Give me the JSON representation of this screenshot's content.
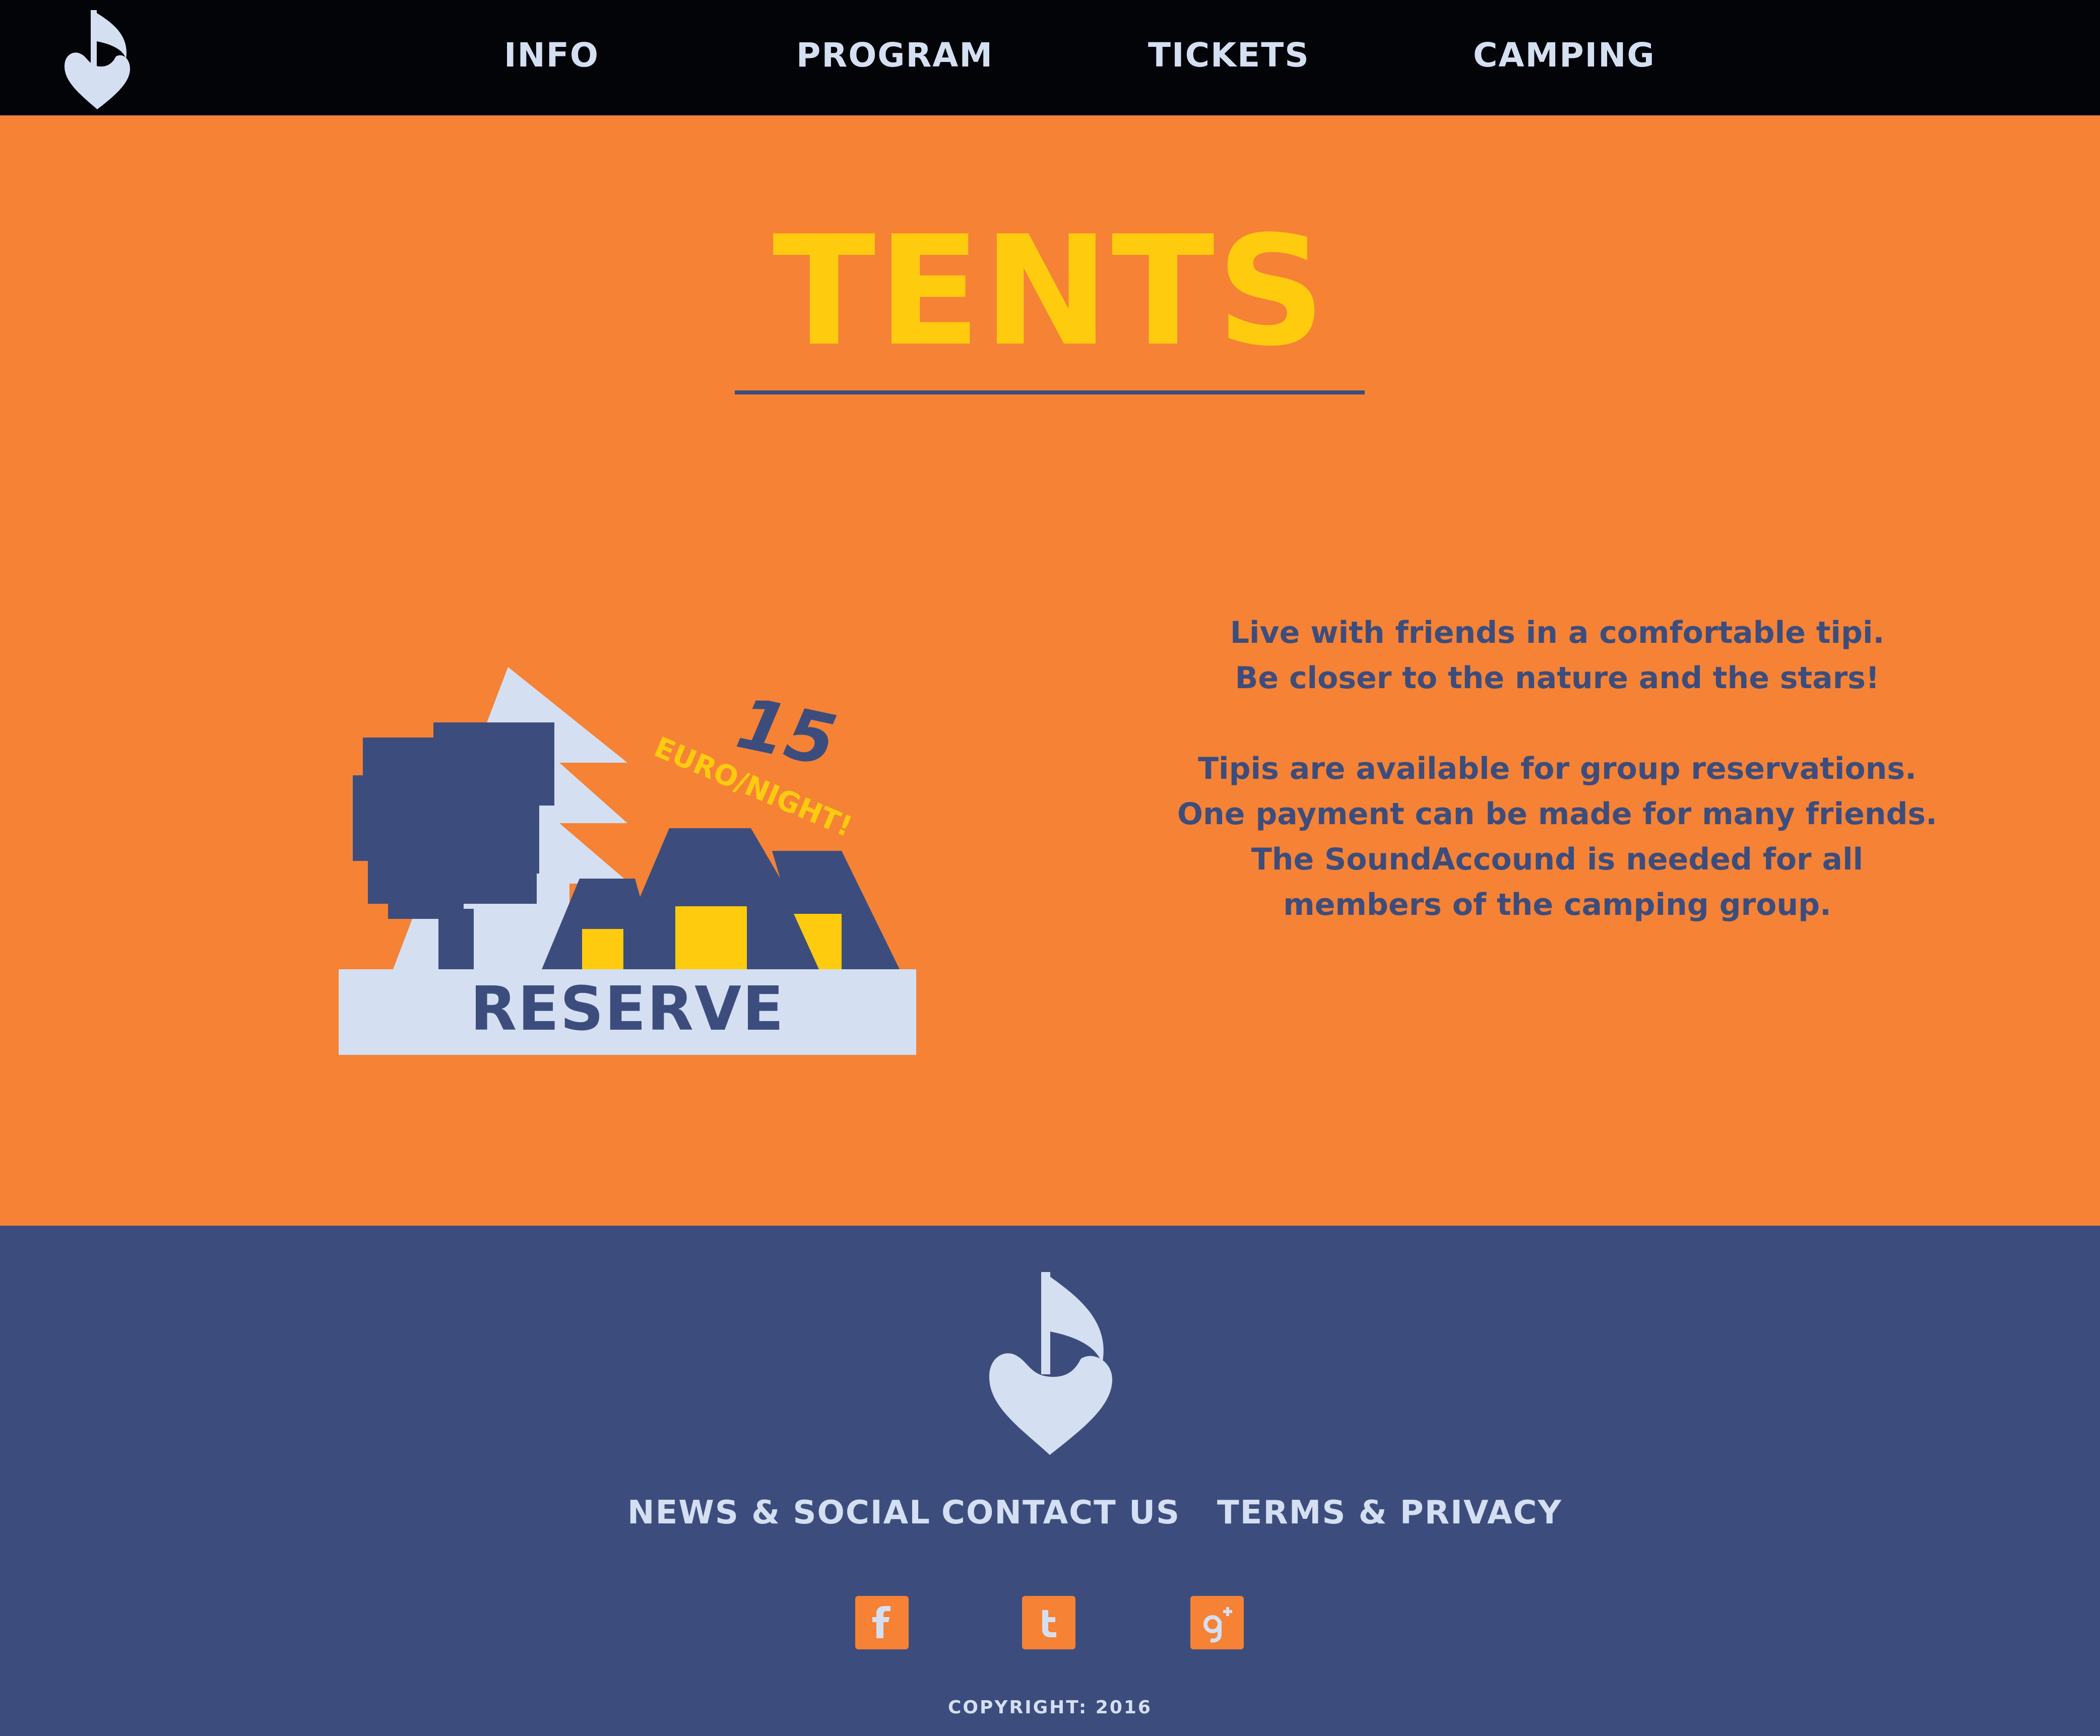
{
  "colors": {
    "nav_bg": "#030408",
    "page_bg": "#F58235",
    "title": "#FFCB0E",
    "accent_dark": "#3C4D7D",
    "light": "#D5DFF2",
    "footer_bg": "#3C4D7D"
  },
  "nav": {
    "logo_icon": "music-note-heart-icon",
    "items": [
      {
        "label": "INFO"
      },
      {
        "label": "PROGRAM"
      },
      {
        "label": "TICKETS"
      },
      {
        "label": "CAMPING"
      }
    ]
  },
  "main": {
    "title": "TENTS",
    "reserve": {
      "label": "RESERVE",
      "price_number": "15",
      "price_unit": "EURO/NIGHT!"
    },
    "description": [
      "Live with friends in a comfortable tipi.",
      "Be closer to the nature and the stars!",
      "",
      "Tipis are available for group reservations.",
      "One payment can be made for many friends.",
      "The SoundAccound is needed for all",
      "members of the camping group."
    ]
  },
  "footer": {
    "logo_icon": "music-note-heart-icon",
    "links": [
      {
        "label": "NEWS & SOCIAL"
      },
      {
        "label": "CONTACT US"
      },
      {
        "label": "TERMS & PRIVACY"
      }
    ],
    "social": [
      {
        "icon": "facebook-icon",
        "glyph": "f"
      },
      {
        "icon": "twitter-icon",
        "glyph": "t"
      },
      {
        "icon": "google-plus-icon",
        "glyph": "g+"
      }
    ],
    "copyright": "COPYRIGHT: 2016"
  }
}
